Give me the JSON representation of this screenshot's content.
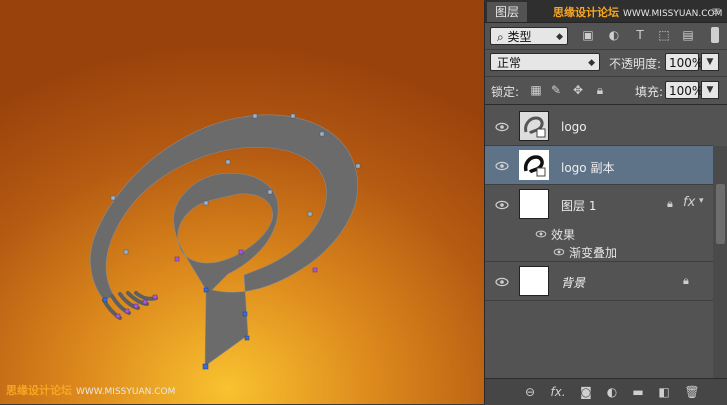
{
  "watermark": {
    "name": "思缘设计论坛",
    "site": "WWW.MISSYUAN.COM"
  },
  "panel": {
    "tab_label": "图层",
    "menu_glyph": "≡",
    "filter": {
      "label": "类型",
      "icons": [
        "image-filter-icon",
        "adjustment-filter-icon",
        "type-filter-icon",
        "shape-filter-icon",
        "smart-object-filter-icon"
      ]
    },
    "blend_mode": "正常",
    "opacity_label": "不透明度:",
    "opacity_value": "100%",
    "lock_label": "锁定:",
    "fill_label": "填充:",
    "fill_value": "100%",
    "layers": [
      {
        "name": "logo",
        "selected": false
      },
      {
        "name": "logo 副本",
        "selected": true
      },
      {
        "name": "图层 1",
        "selected": false,
        "effects_label": "效果",
        "effect": "渐变叠加"
      },
      {
        "name": "背景",
        "selected": false
      }
    ],
    "bottom_icons": [
      "link-layers-icon",
      "fx-icon",
      "add-mask-icon",
      "adjustment-layer-icon",
      "new-group-icon",
      "new-layer-icon",
      "delete-layer-icon"
    ]
  },
  "colors": {
    "canvas_bg": "#a1470f",
    "canvas_glow": "#f2b12c",
    "shape": "#6b6b6b",
    "selected_layer": "#5f7388",
    "accent_watermark": "#f6a623"
  }
}
